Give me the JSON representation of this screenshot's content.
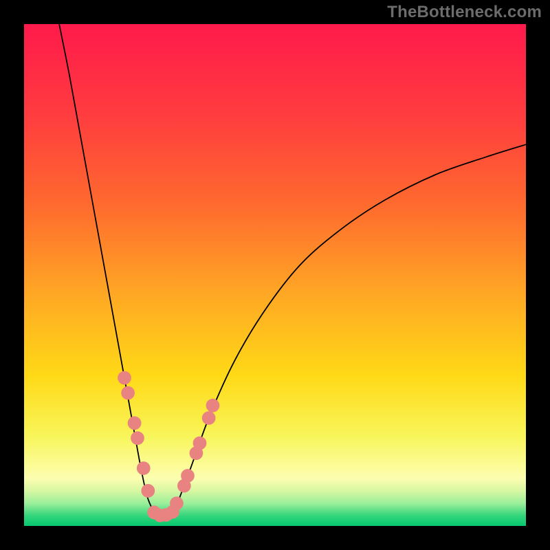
{
  "watermark": "TheBottleneck.com",
  "colors": {
    "frame": "#000000",
    "curve": "#000000",
    "marker_fill": "#e98381",
    "marker_stroke": "#e98381",
    "gradient_stops": [
      {
        "pos": 0.0,
        "color": "#ff1a4b"
      },
      {
        "pos": 0.18,
        "color": "#ff3c3f"
      },
      {
        "pos": 0.36,
        "color": "#ff6a2e"
      },
      {
        "pos": 0.54,
        "color": "#ffa824"
      },
      {
        "pos": 0.7,
        "color": "#ffd916"
      },
      {
        "pos": 0.82,
        "color": "#f8f559"
      },
      {
        "pos": 0.905,
        "color": "#fdfeb0"
      },
      {
        "pos": 0.93,
        "color": "#d7f7a2"
      },
      {
        "pos": 0.955,
        "color": "#9bef9a"
      },
      {
        "pos": 0.98,
        "color": "#32d57b"
      },
      {
        "pos": 1.0,
        "color": "#05c86f"
      }
    ]
  },
  "chart_data": {
    "type": "line",
    "title": "",
    "xlabel": "",
    "ylabel": "",
    "xlim": [
      0,
      100
    ],
    "ylim": [
      0,
      100
    ],
    "notes": "Bottleneck-style V curve. Y is bottleneck % (0 at green bottom, 100 at red top). X is component balance axis. Minimum near x≈26.",
    "series": [
      {
        "name": "curve-left",
        "x": [
          7,
          9,
          11,
          13,
          15,
          17,
          19,
          21,
          23,
          24.5,
          26
        ],
        "y": [
          100,
          90,
          79,
          68,
          57,
          46,
          35,
          24,
          13,
          6,
          2.5
        ]
      },
      {
        "name": "curve-bottom",
        "x": [
          26,
          27,
          28,
          29,
          30
        ],
        "y": [
          2.5,
          2.0,
          2.0,
          2.2,
          3.0
        ]
      },
      {
        "name": "curve-right",
        "x": [
          30,
          33,
          37,
          42,
          48,
          55,
          63,
          72,
          82,
          92,
          100
        ],
        "y": [
          3.0,
          11,
          22,
          33,
          43,
          52,
          59,
          65,
          70,
          73.5,
          76
        ]
      }
    ],
    "markers": {
      "name": "highlight-dots",
      "x": [
        20.0,
        20.7,
        22.0,
        22.6,
        23.8,
        24.7,
        25.9,
        27.1,
        28.3,
        29.6,
        30.4,
        31.9,
        32.6,
        34.3,
        35.0,
        36.8,
        37.6
      ],
      "y": [
        29.5,
        26.5,
        20.5,
        17.5,
        11.5,
        7.0,
        2.7,
        2.1,
        2.2,
        2.8,
        4.5,
        8.0,
        10.0,
        14.5,
        16.5,
        21.5,
        24.0
      ],
      "r": 1.3
    }
  }
}
